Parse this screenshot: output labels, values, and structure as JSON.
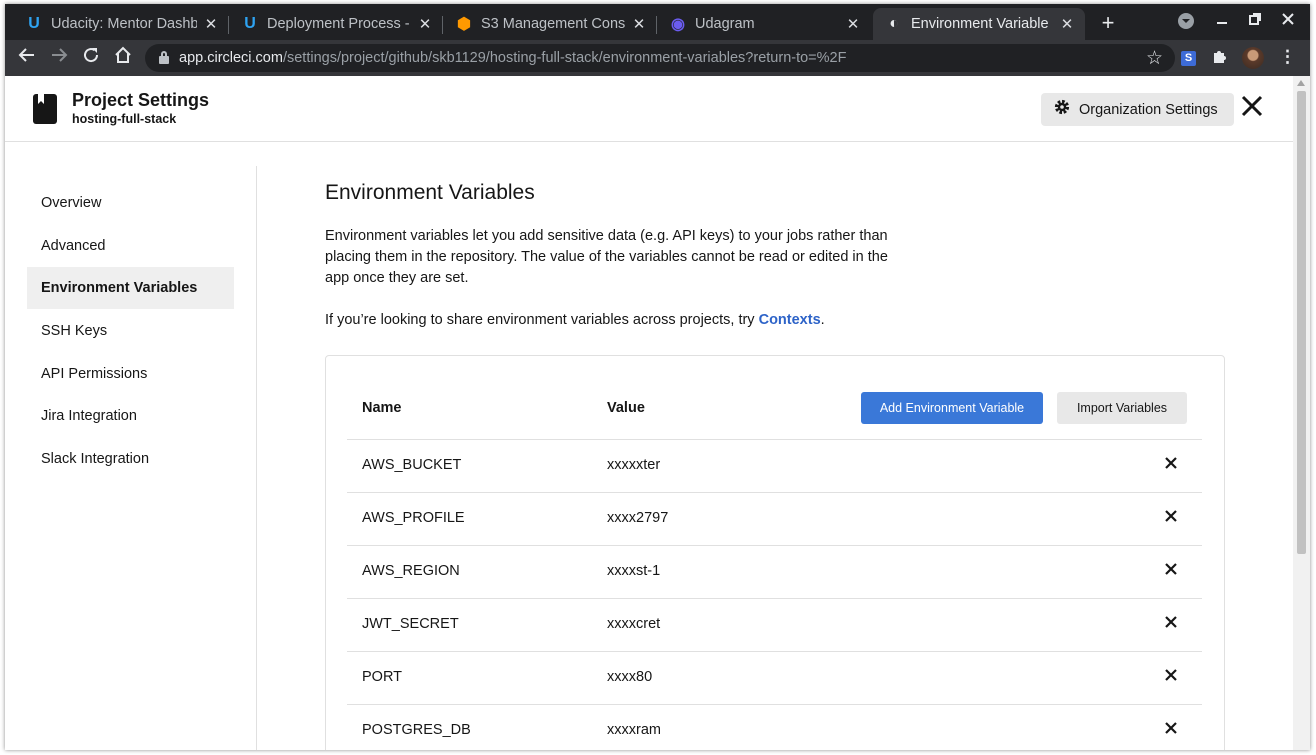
{
  "browser": {
    "tabs": [
      {
        "title": "Udacity: Mentor Dashb",
        "favicon": "udacity-icon",
        "fav_char": "U",
        "fav_color": "#2ea3f2"
      },
      {
        "title": "Deployment Process - ",
        "favicon": "udacity-icon",
        "fav_char": "U",
        "fav_color": "#2ea3f2"
      },
      {
        "title": "S3 Management Cons",
        "favicon": "aws-icon",
        "fav_char": "⬢",
        "fav_color": "#ff9900"
      },
      {
        "title": "Udagram",
        "favicon": "ionic-icon",
        "fav_char": "◉",
        "fav_color": "#6b5cf0"
      },
      {
        "title": "Environment Variable",
        "favicon": "circleci-icon",
        "fav_char": "◐",
        "fav_color": "#e8eaed"
      }
    ],
    "close_glyph": "✕",
    "new_tab_glyph": "+",
    "url_host": "app.circleci.com",
    "url_path": "/settings/project/github/skb1129/hosting-full-stack/environment-variables?return-to=%2F",
    "extension_label": "S"
  },
  "header": {
    "title": "Project Settings",
    "subtitle": "hosting-full-stack",
    "org_button": "Organization Settings"
  },
  "sidebar": {
    "items": [
      {
        "label": "Overview",
        "active": false
      },
      {
        "label": "Advanced",
        "active": false
      },
      {
        "label": "Environment Variables",
        "active": true
      },
      {
        "label": "SSH Keys",
        "active": false
      },
      {
        "label": "API Permissions",
        "active": false
      },
      {
        "label": "Jira Integration",
        "active": false
      },
      {
        "label": "Slack Integration",
        "active": false
      }
    ]
  },
  "main": {
    "title": "Environment Variables",
    "description": "Environment variables let you add sensitive data (e.g. API keys) to your jobs rather than placing them in the repository. The value of the variables cannot be read or edited in the app once they are set.",
    "share_text": "If you’re looking to share environment variables across projects, try ",
    "share_link": "Contexts",
    "share_end": "."
  },
  "table": {
    "col_name": "Name",
    "col_value": "Value",
    "add_button": "Add Environment Variable",
    "import_button": "Import Variables",
    "rows": [
      {
        "name": "AWS_BUCKET",
        "value": "xxxxxter"
      },
      {
        "name": "AWS_PROFILE",
        "value": "xxxx2797"
      },
      {
        "name": "AWS_REGION",
        "value": "xxxxst-1"
      },
      {
        "name": "JWT_SECRET",
        "value": "xxxxcret"
      },
      {
        "name": "PORT",
        "value": "xxxx80"
      },
      {
        "name": "POSTGRES_DB",
        "value": "xxxxram"
      }
    ]
  },
  "colors": {
    "accent": "#3a78d8",
    "link": "#2d63c8",
    "active_nav_bg": "#efefef"
  }
}
